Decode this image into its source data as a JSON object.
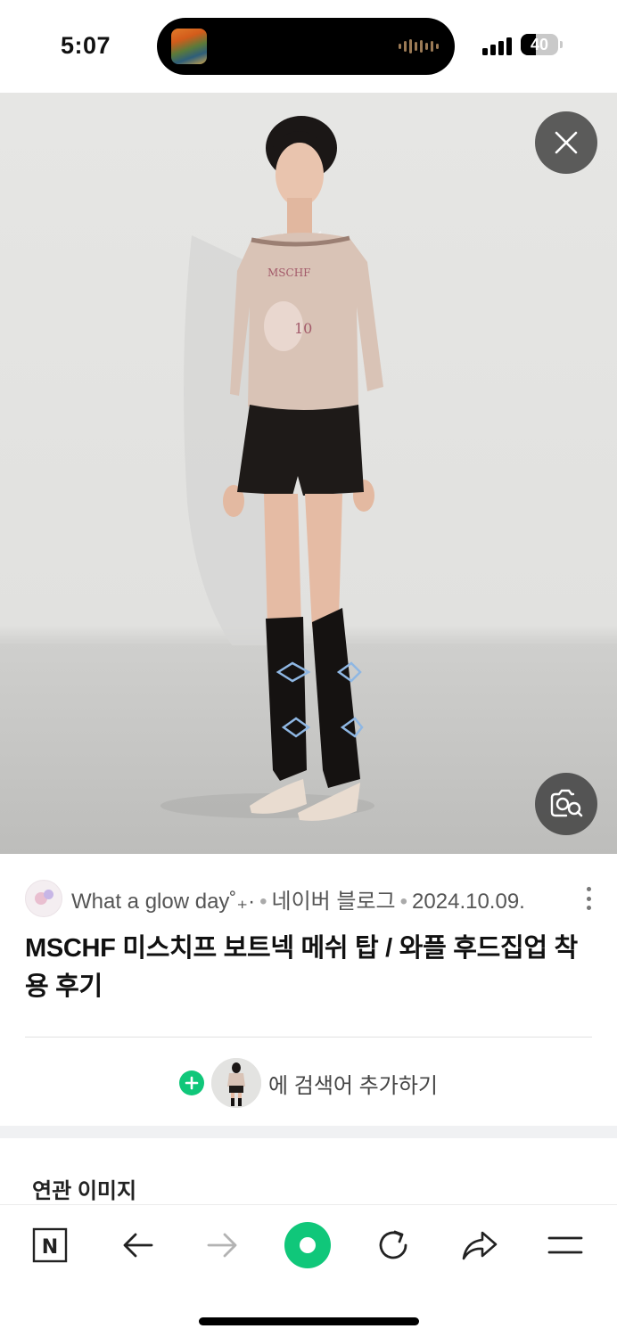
{
  "status_bar": {
    "time": "5:07",
    "battery": "40",
    "battery_level_percent": 40
  },
  "viewer": {
    "close_icon": "close-icon",
    "lens_icon": "image-search-icon"
  },
  "result": {
    "blog_name": "What a glow day˚₊·",
    "source": "네이버 블로그",
    "date": "2024.10.09.",
    "title": "MSCHF 미스치프 보트넥 메쉬 탑 / 와플 후드집업 착용 후기",
    "more_icon": "more-vertical-icon"
  },
  "add_search": {
    "label": "에 검색어 추가하기",
    "accent": "#10c77a"
  },
  "related": {
    "heading": "연관 이미지"
  },
  "bottom_bar": {
    "items": [
      {
        "name": "naver-home-icon",
        "glyph": "N"
      },
      {
        "name": "back-arrow-icon"
      },
      {
        "name": "forward-arrow-icon"
      },
      {
        "name": "green-dot-icon",
        "color": "#10c77a"
      },
      {
        "name": "refresh-icon"
      },
      {
        "name": "share-icon"
      },
      {
        "name": "menu-icon"
      }
    ]
  }
}
